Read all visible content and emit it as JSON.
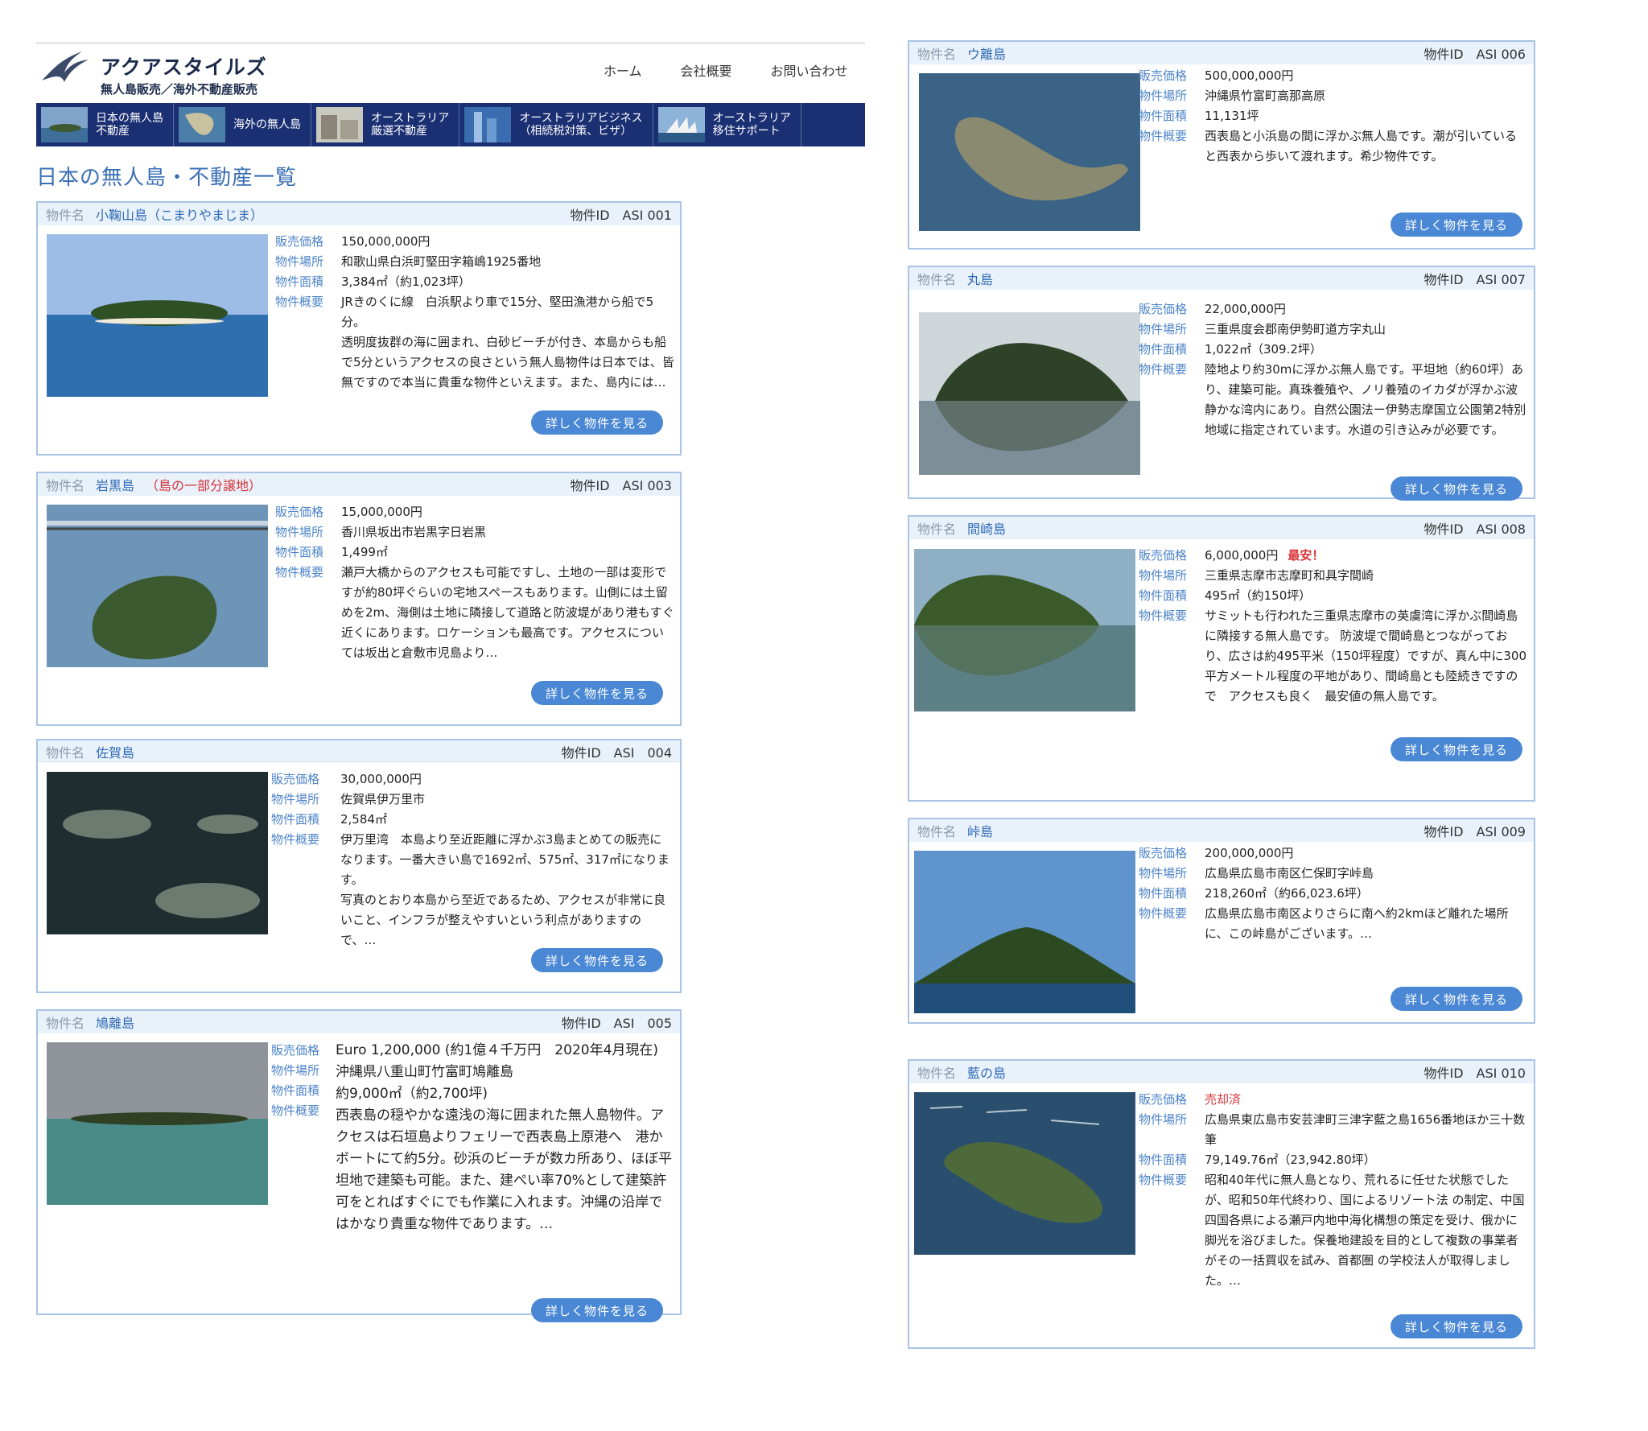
{
  "brand": {
    "name": "アクアスタイルズ",
    "tagline": "無人島販売／海外不動産販売"
  },
  "topnav": [
    "ホーム",
    "会社概要",
    "お問い合わせ"
  ],
  "nav": [
    {
      "label": "日本の無人島\n不動産"
    },
    {
      "label": "海外の無人島"
    },
    {
      "label": "オーストラリア\n厳選不動産"
    },
    {
      "label": "オーストラリアビジネス\n（相続税対策、ビザ）"
    },
    {
      "label": "オーストラリア\n移住サポート"
    }
  ],
  "page_title": "日本の無人島・不動産一覧",
  "labels": {
    "name": "物件名",
    "price": "販売価格",
    "location": "物件場所",
    "area": "物件面積",
    "summary": "物件概要",
    "button": "詳しく物件を見る"
  },
  "properties": [
    {
      "name": "小鞠山島（こまりやまじま）",
      "note": "",
      "id": "物件ID　ASI 001",
      "price": "150,000,000円",
      "badge": "",
      "location": "和歌山県白浜町堅田字箱嶋1925番地",
      "area": "3,384㎡（約1,023坪）",
      "summary": "JRきのくに線　白浜駅より車で15分、堅田漁港から船で5分。\n透明度抜群の海に囲まれ、白砂ビーチが付き、本島からも船で5分というアクセスの良さという無人島物件は日本では、皆無ですので本当に貴重な物件といえます。また、島内には…"
    },
    {
      "name": "岩黒島",
      "note": "（島の一部分譲地）",
      "id": "物件ID　ASI 003",
      "price": "15,000,000円",
      "badge": "",
      "location": "香川県坂出市岩黒字日岩黒",
      "area": "1,499㎡",
      "summary": "瀬戸大橋からのアクセスも可能ですし、土地の一部は変形ですが約80坪ぐらいの宅地スペースもあります。山側には土留めを2m、海側は土地に隣接して道路と防波堤があり港もすぐ近くにあります。ロケーションも最高です。アクセスについては坂出と倉敷市児島より…"
    },
    {
      "name": "佐賀島",
      "note": "",
      "id": "物件ID　ASI　004",
      "price": "30,000,000円",
      "badge": "",
      "location": "佐賀県伊万里市",
      "area": "2,584㎡",
      "summary": "伊万里湾　本島より至近距離に浮かぶ3島まとめての販売になります。一番大きい島で1692㎡、575㎡、317㎡になります。\n写真のとおり本島から至近であるため、アクセスが非常に良いこと、インフラが整えやすいという利点がありますので、…"
    },
    {
      "name": "鳩離島",
      "note": "",
      "id": "物件ID　ASI　005",
      "price": "Euro 1,200,000 (約1億４千万円　2020年4月現在)",
      "badge": "",
      "location": "沖縄県八重山町竹富町鳩離島",
      "area": "約9,000㎡（約2,700坪)",
      "summary": "西表島の穏やかな遠浅の海に囲まれた無人島物件。アクセスは石垣島よりフェリーで西表島上原港へ　港かボートにて約5分。砂浜のビーチが数カ所あり、ほぼ平坦地で建築も可能。また、建ぺい率70%として建築許可をとればすぐにでも作業に入れます。沖縄の沿岸ではかなり貴重な物件であります。…"
    },
    {
      "name": "ウ離島",
      "note": "",
      "id": "物件ID　ASI 006",
      "price": "500,000,000円",
      "badge": "",
      "location": "沖縄県竹富町高那高原",
      "area": "11,131坪",
      "summary": "西表島と小浜島の間に浮かぶ無人島です。潮が引いていると西表から歩いて渡れます。希少物件です。"
    },
    {
      "name": "丸島",
      "note": "",
      "id": "物件ID　ASI 007",
      "price": "22,000,000円",
      "badge": "",
      "location": "三重県度会郡南伊勢町道方字丸山",
      "area": "1,022㎡（309.2坪）",
      "summary": "陸地より約30mに浮かぶ無人島です。平坦地（約60坪）あり、建築可能。真珠養殖や、ノリ養殖のイカダが浮かぶ波静かな湾内にあり。自然公園法ー伊勢志摩国立公園第2特別地域に指定されています。水道の引き込みが必要です。"
    },
    {
      "name": "間崎島",
      "note": "",
      "id": "物件ID　ASI 008",
      "price": "6,000,000円",
      "badge": "最安！",
      "location": "三重県志摩市志摩町和具字間崎",
      "area": "495㎡（約150坪）",
      "summary": "サミットも行われた三重県志摩市の英虞湾に浮かぶ間崎島に隣接する無人島です。 防波堤で間崎島とつながっており、広さは約495平米（150坪程度）ですが、真ん中に300平方メートル程度の平地があり、間崎島とも陸続きですので　アクセスも良く　最安値の無人島です。"
    },
    {
      "name": "峠島",
      "note": "",
      "id": "物件ID　ASI 009",
      "price": "200,000,000円",
      "badge": "",
      "location": "広島県広島市南区仁保町字峠島",
      "area": "218,260㎡（約66,023.6坪）",
      "summary": "広島県広島市南区よりさらに南へ約2kmほど離れた場所に、この峠島がございます。…"
    },
    {
      "name": "藍の島",
      "note": "",
      "id": "物件ID　ASI 010",
      "price": "売却済",
      "badge": "",
      "location": "広島県東広島市安芸津町三津字藍之島1656番地ほか三十数筆",
      "area": "79,149.76㎡（23,942.80坪）",
      "summary": "昭和40年代に無人島となり、荒れるに任せた状態でしたが、昭和50年代終わり、国によるリゾート法 の制定、中国四国各県による瀬戸内地中海化構想の策定を受け、俄かに脚光を浴びました。保養地建設を目的として複数の事業者がその一括買収を試み、首都圏 の学校法人が取得しました。…"
    }
  ],
  "colors": {
    "navbar": "#1b2f73",
    "accent": "#2f6bb5",
    "button": "#4a87d4",
    "card_border": "#a9c4e4",
    "alert": "#d8343a"
  }
}
